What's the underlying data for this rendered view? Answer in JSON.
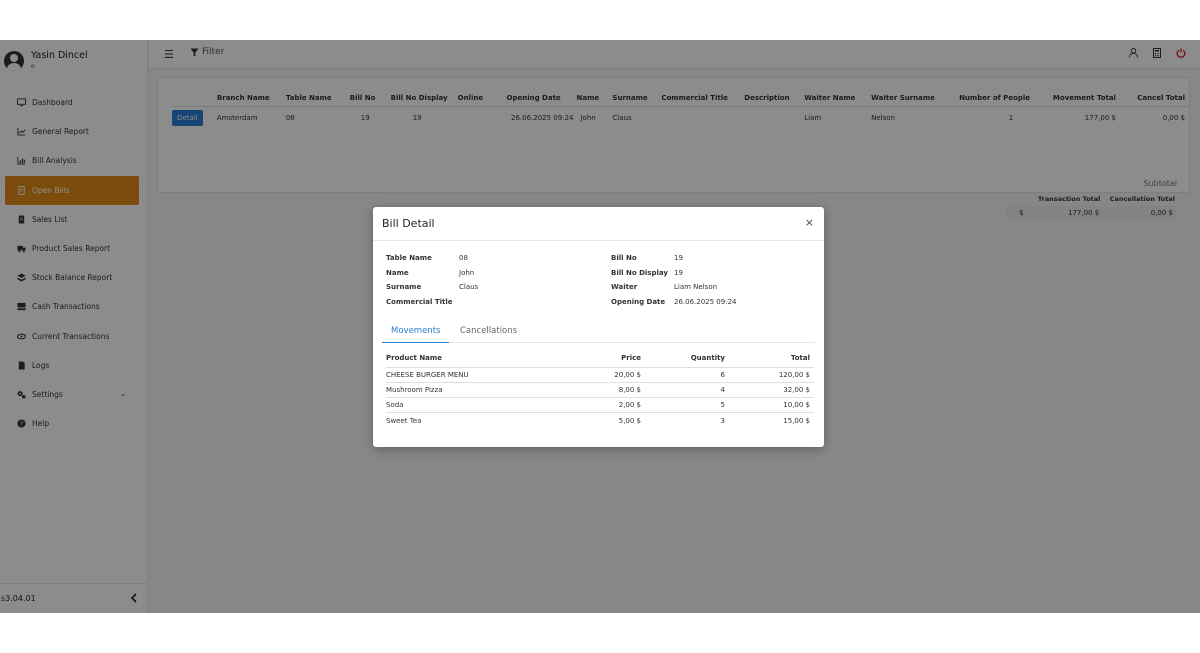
{
  "user": {
    "name": "Yasin Dincel",
    "sub": "o"
  },
  "sidebar": {
    "items": [
      {
        "label": "Dashboard",
        "icon": "monitor-icon"
      },
      {
        "label": "General Report",
        "icon": "chart-icon"
      },
      {
        "label": "Bill Analysis",
        "icon": "bar-chart-icon"
      },
      {
        "label": "Open Bills",
        "icon": "receipt-icon",
        "active": true
      },
      {
        "label": "Sales List",
        "icon": "list-icon"
      },
      {
        "label": "Product Sales Report",
        "icon": "truck-icon"
      },
      {
        "label": "Stock Balance Report",
        "icon": "cubes-icon"
      },
      {
        "label": "Cash Transactions",
        "icon": "cash-icon"
      },
      {
        "label": "Current Transactions",
        "icon": "transfer-icon"
      },
      {
        "label": "Logs",
        "icon": "log-icon"
      },
      {
        "label": "Settings",
        "icon": "gears-icon",
        "expandable": true
      },
      {
        "label": "Help",
        "icon": "help-icon"
      }
    ],
    "version": "s3.04.01"
  },
  "topbar": {
    "filter_label": "Filter"
  },
  "bills_table": {
    "headers": [
      "Branch Name",
      "Table Name",
      "Bill No",
      "Bill No Display",
      "Online",
      "Opening Date",
      "Name",
      "Surname",
      "Commercial Title",
      "Description",
      "Waiter Name",
      "Waiter Surname",
      "Number of People",
      "Movement Total",
      "Cancel Total"
    ],
    "row": {
      "detail_button": "Detail",
      "branch_name": "Amsterdam",
      "table_name": "08",
      "bill_no": "19",
      "bill_no_display": "19",
      "online": "",
      "opening_date": "26.06.2025 09:24",
      "name": "John",
      "surname": "Claus",
      "commercial_title": "",
      "description": "",
      "waiter_name": "Liam",
      "waiter_surname": "Nelson",
      "number_of_people": "1",
      "movement_total": "177,00 $",
      "cancel_total": "0,00 $"
    }
  },
  "subtotal": {
    "label": "Subtotal",
    "transaction_total_label": "Transaction Total",
    "cancellation_total_label": "Cancellation Total",
    "currency": "$",
    "transaction_total": "177,00 $",
    "cancellation_total": "0,00 $"
  },
  "modal": {
    "title": "Bill Detail",
    "close": "×",
    "left": {
      "table_name_label": "Table Name",
      "table_name": "08",
      "name_label": "Name",
      "name": "John",
      "surname_label": "Surname",
      "surname": "Claus",
      "commercial_title_label": "Commercial Title",
      "commercial_title": ""
    },
    "right": {
      "bill_no_label": "Bill No",
      "bill_no": "19",
      "bill_no_display_label": "Bill No Display",
      "bill_no_display": "19",
      "waiter_label": "Waiter",
      "waiter": "Liam Nelson",
      "opening_date_label": "Opening Date",
      "opening_date": "26.06.2025 09:24"
    },
    "tabs": [
      "Movements",
      "Cancellations"
    ],
    "movements": {
      "headers": [
        "Product Name",
        "Price",
        "Quantity",
        "Total"
      ],
      "rows": [
        [
          "CHEESE BURGER MENU",
          "20,00 $",
          "6",
          "120,00 $"
        ],
        [
          "Mushroom Pizza",
          "8,00 $",
          "4",
          "32,00 $"
        ],
        [
          "Soda",
          "2,00 $",
          "5",
          "10,00 $"
        ],
        [
          "Sweet Tea",
          "5,00 $",
          "3",
          "15,00 $"
        ]
      ]
    }
  },
  "colors": {
    "accent": "#e08a17",
    "primary": "#2b7fd6",
    "power": "#d9262c"
  }
}
